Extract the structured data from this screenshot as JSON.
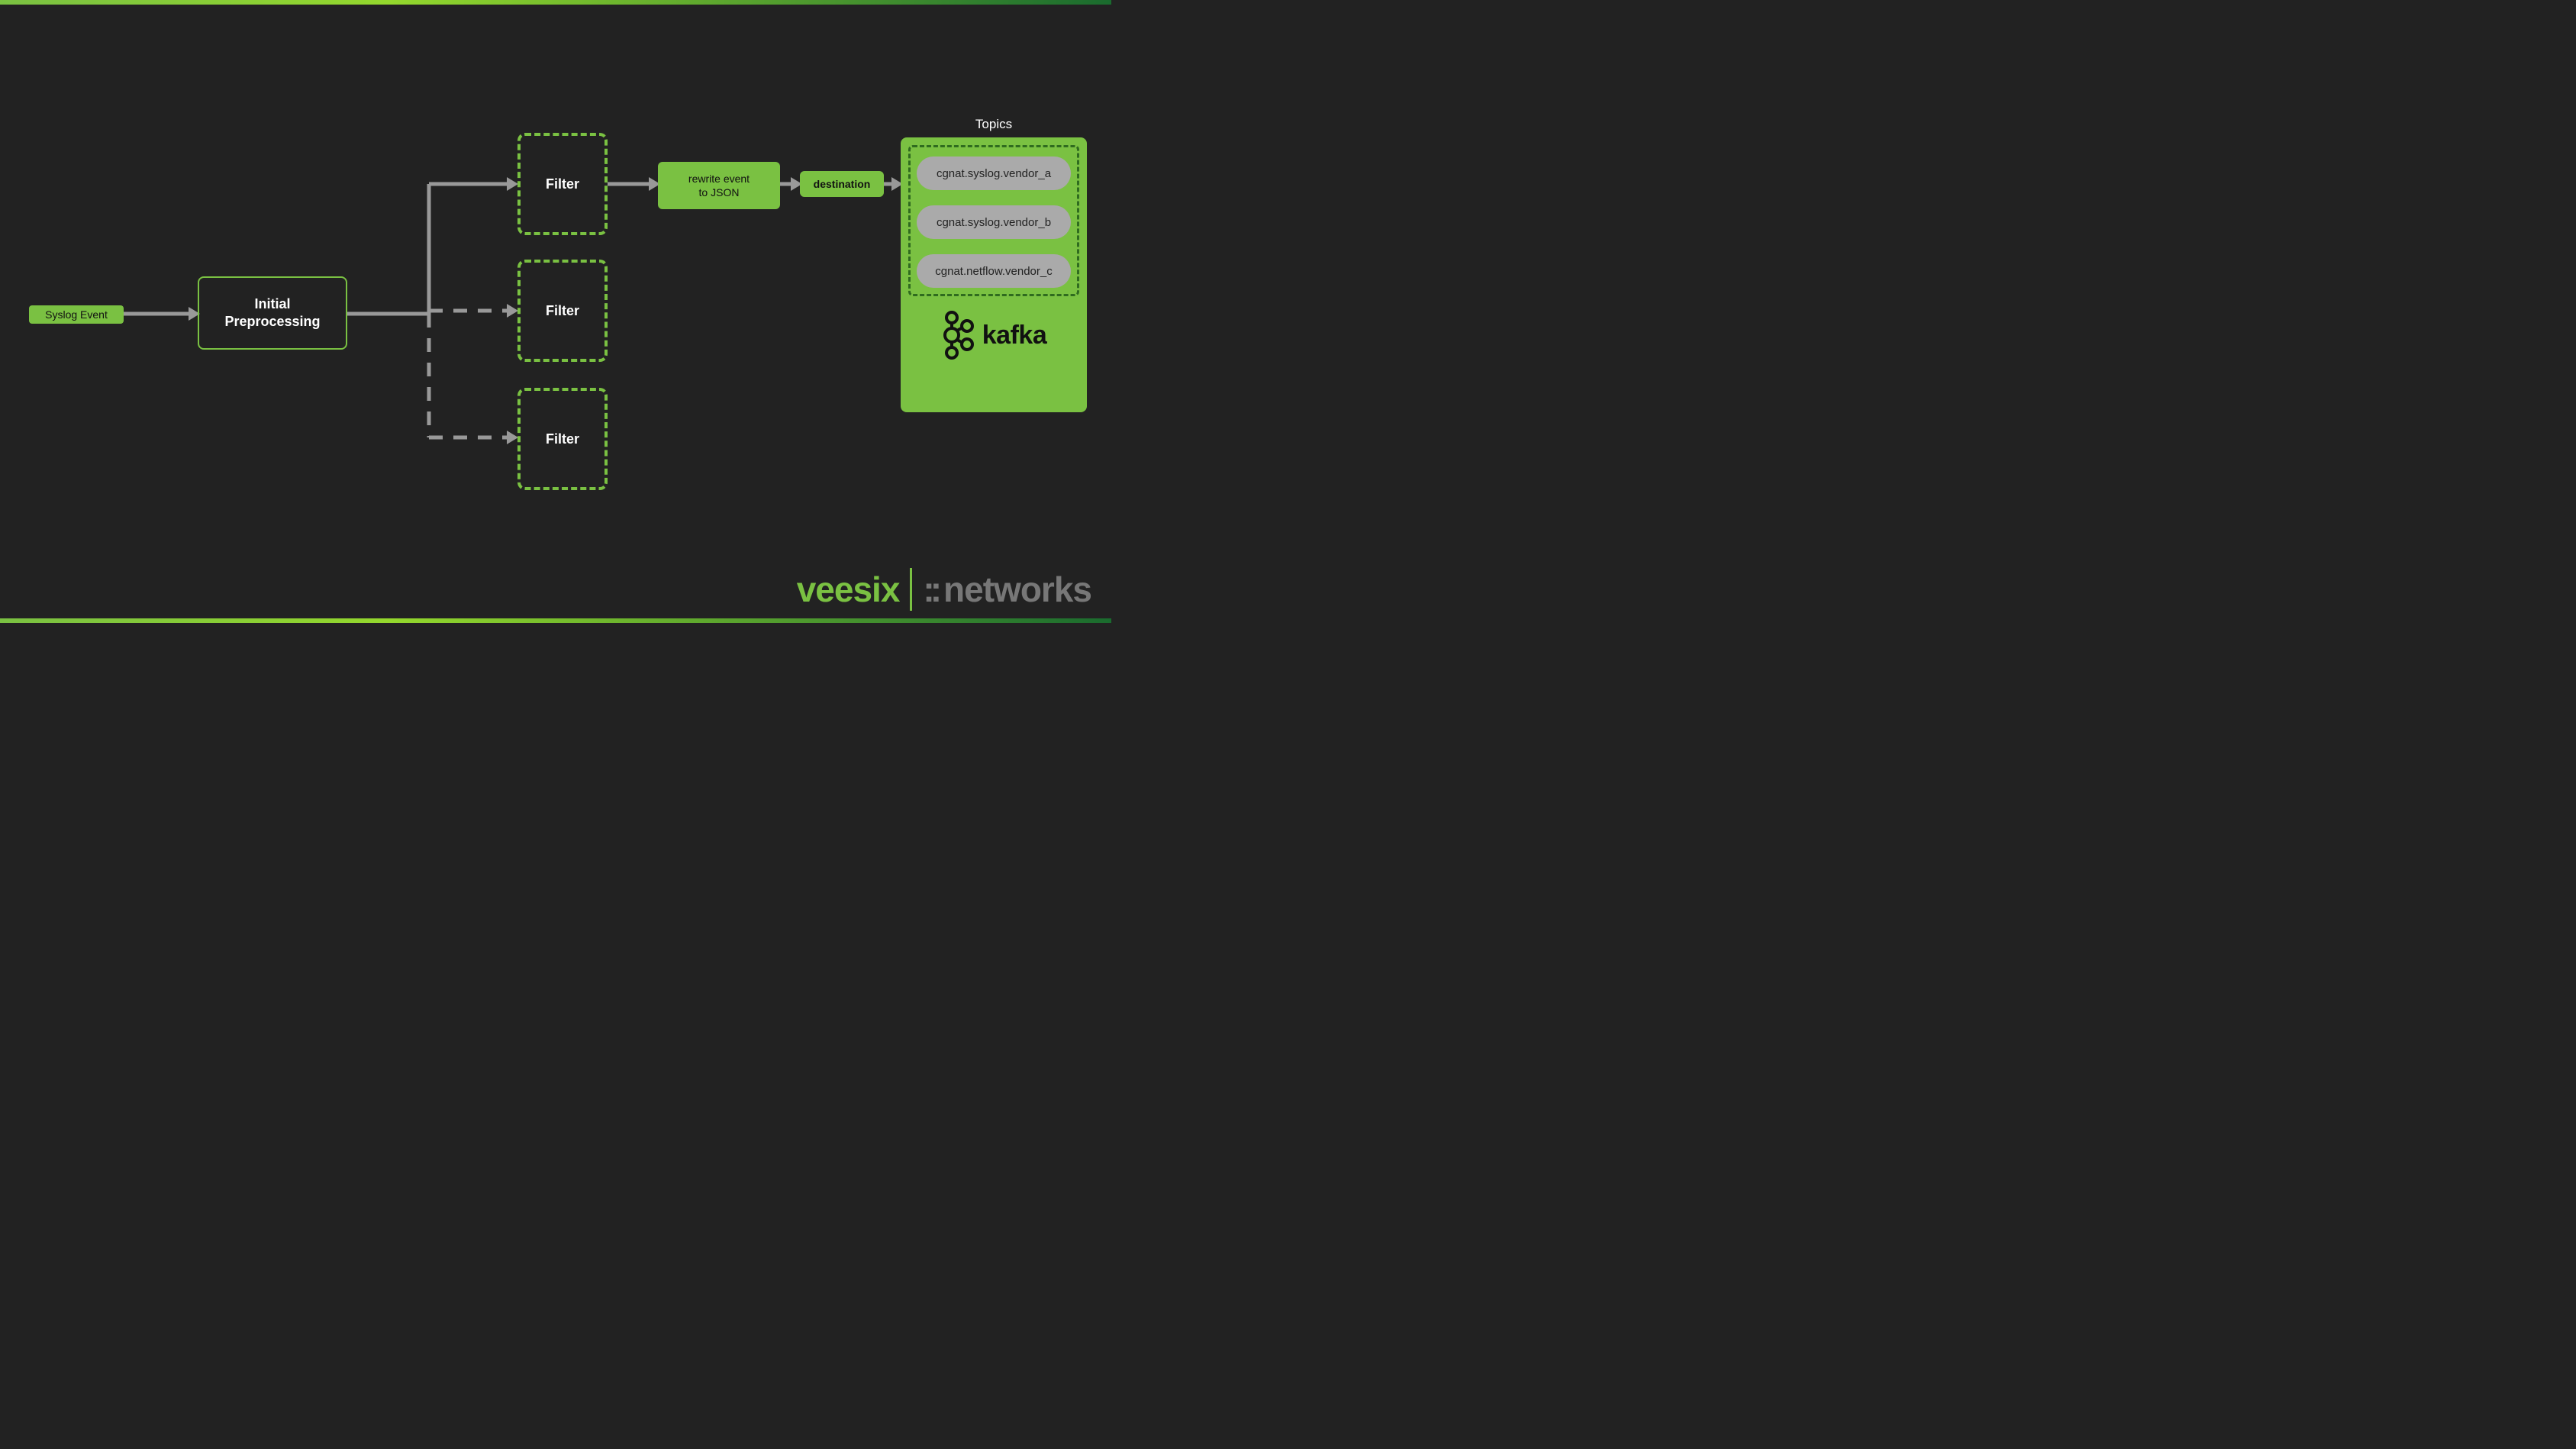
{
  "source": {
    "label": "Syslog Event"
  },
  "preprocessing": {
    "label": "Initial\nPreprocessing"
  },
  "filters": {
    "label_1": "Filter",
    "label_2": "Filter",
    "label_3": "Filter"
  },
  "rewrite": {
    "label": "rewrite event\nto JSON"
  },
  "destination": {
    "label": "destination"
  },
  "topics_header": "Topics",
  "kafka": {
    "brand": "kafka",
    "topics": {
      "t0": "cgnat.syslog.vendor_a",
      "t1": "cgnat.syslog.vendor_b",
      "t2": "cgnat.netflow.vendor_c"
    }
  },
  "brand": {
    "left": "veesix",
    "right_prefix": "::",
    "right": "networks"
  },
  "colors": {
    "accent": "#7ac142",
    "bg": "#222222",
    "muted": "#999999",
    "pill": "#aaaaaa"
  }
}
